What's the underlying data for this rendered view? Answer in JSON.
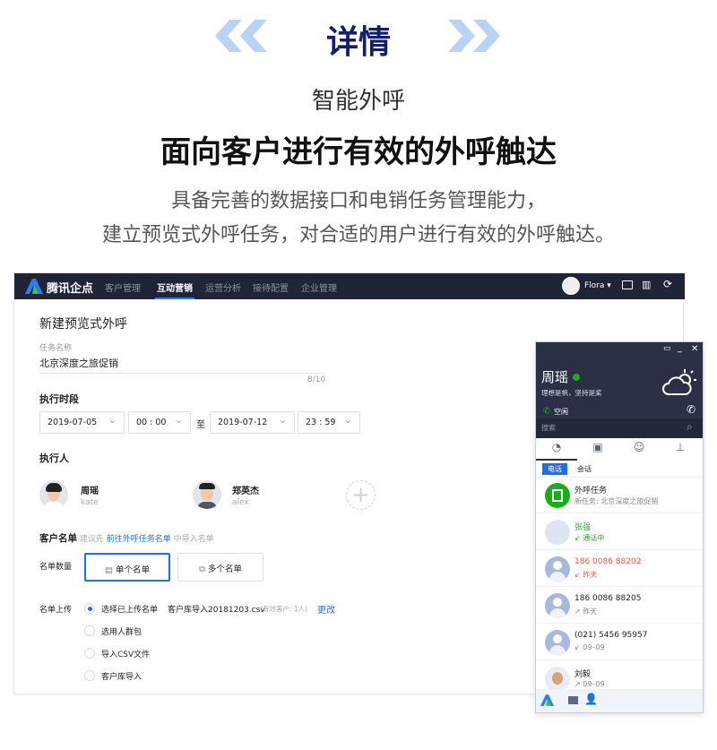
{
  "header": {
    "title": "详情",
    "subtitle": "智能外呼",
    "headline": "面向客户进行有效的外呼触达",
    "description": [
      "具备完善的数据接口和电销任务管理能力，",
      "建立预览式外呼任务，对合适的用户进行有效的外呼触达。"
    ]
  },
  "colors": {
    "brand_navy": "#141d6e",
    "chevron": "#b9d3f5",
    "nav_bg": "#1f2436",
    "accent": "#1f6ef0",
    "green": "#1aad19",
    "missed": "#f5533d"
  },
  "app": {
    "logo": "腾讯企点",
    "nav": [
      "客户管理",
      "互动营销",
      "运营分析",
      "接待配置",
      "企业管理"
    ],
    "nav_active": "互动营销",
    "user": "Flora",
    "icons": [
      "mail-icon",
      "book-icon",
      "logout-icon"
    ],
    "page_title": "新建预览式外呼",
    "task_name": {
      "label": "任务名称",
      "value": "北京深度之旅促销",
      "counter": "8/10"
    },
    "period": {
      "label": "执行时段",
      "start_date": "2019-07-05",
      "start_time": "00 : 00",
      "to": "至",
      "end_date": "2019-07-12",
      "end_time": "23 : 59"
    },
    "executors": {
      "label": "执行人",
      "people": [
        {
          "name": "周瑶",
          "id": "kate"
        },
        {
          "name": "郑英杰",
          "id": "alex"
        }
      ]
    },
    "customer_list": {
      "label": "客户名单",
      "hint_pre": "建议先",
      "hint_link": "前往外呼任务名单",
      "hint_post": "中导入名单"
    },
    "list_count": {
      "label": "名单数量",
      "options": [
        "单个名单",
        "多个名单"
      ],
      "selected": "单个名单"
    },
    "upload": {
      "label": "名单上传",
      "options": [
        "选择已上传名单",
        "选用人群包",
        "导入CSV文件",
        "客户库导入"
      ],
      "selected": "选择已上传名单",
      "file": "客户库导入20181203.csv",
      "file_note": "(有效客户: 1人)",
      "change": "更改"
    }
  },
  "phone": {
    "name": "周瑶",
    "motto": "理想是帆，坚持是桨",
    "status": "空闲",
    "search_placeholder": "搜索",
    "tabs": [
      "recent-icon",
      "contact-card-icon",
      "contacts-icon",
      "org-icon"
    ],
    "subtabs": [
      "电话",
      "会话"
    ],
    "subtab_active": "电话",
    "items": [
      {
        "title": "外呼任务",
        "sub": "新任务: 北京深度之旅促销",
        "type": "task"
      },
      {
        "title": "张强",
        "sub": "↙ 通话中",
        "type": "active"
      },
      {
        "title": "186 0086 88202",
        "sub": "↙ 昨天",
        "type": "missed"
      },
      {
        "title": "186 0086 88205",
        "sub": "↗ 昨天",
        "type": "normal"
      },
      {
        "title": "(021) 5456 95957",
        "sub": "↙ 09–09",
        "type": "normal"
      },
      {
        "title": "刘毅",
        "sub": "↗ 09–09",
        "type": "photo"
      }
    ]
  }
}
